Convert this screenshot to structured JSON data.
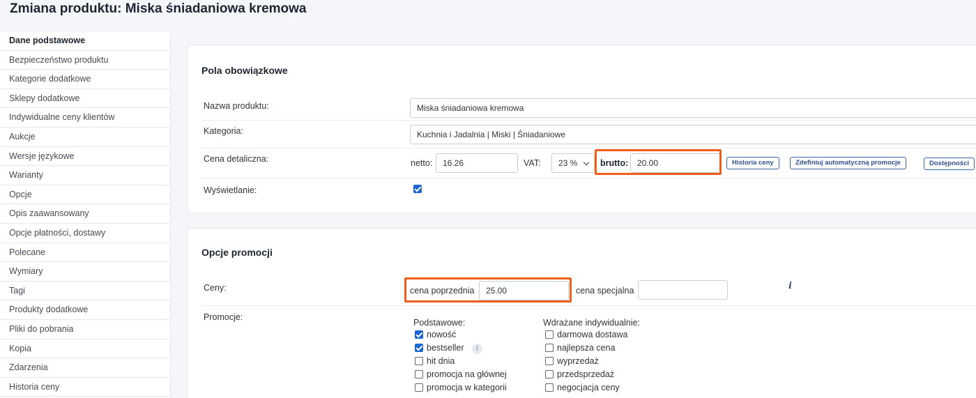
{
  "page": {
    "title": "Zmiana produktu: Miska śniadaniowa kremowa"
  },
  "sidebar": {
    "items": [
      {
        "label": "Dane podstawowe",
        "active": true
      },
      {
        "label": "Bezpieczeństwo produktu"
      },
      {
        "label": "Kategorie dodatkowe"
      },
      {
        "label": "Sklepy dodatkowe"
      },
      {
        "label": "Indywidualne ceny klientów"
      },
      {
        "label": "Aukcje"
      },
      {
        "label": "Wersje językowe"
      },
      {
        "label": "Warianty"
      },
      {
        "label": "Opcje"
      },
      {
        "label": "Opis zaawansowany"
      },
      {
        "label": "Opcje płatności, dostawy"
      },
      {
        "label": "Polecane"
      },
      {
        "label": "Wymiary"
      },
      {
        "label": "Tagi"
      },
      {
        "label": "Produkty dodatkowe"
      },
      {
        "label": "Pliki do pobrania"
      },
      {
        "label": "Kopia"
      },
      {
        "label": "Zdarzenia"
      },
      {
        "label": "Historia ceny"
      }
    ]
  },
  "required": {
    "title": "Pola obowiązkowe",
    "name": {
      "label": "Nazwa produktu:",
      "value": "Miska śniadaniowa kremowa"
    },
    "category": {
      "label": "Kategoria:",
      "value": "Kuchnia i Jadalnia | Miski | Śniadaniowe"
    },
    "price": {
      "label": "Cena detaliczna:",
      "netto_label": "netto:",
      "netto_value": "16.26",
      "vat_label": "VAT:",
      "vat_value": "23 %",
      "brutto_label": "brutto:",
      "brutto_value": "20.00",
      "history_button": "Historia ceny",
      "auto_promo_button": "Zdefiniuj automatyczną promocje",
      "availability_button": "Dostępności"
    },
    "display": {
      "label": "Wyświetlanie:",
      "checked": true
    }
  },
  "promo": {
    "title": "Opcje promocji",
    "prices": {
      "label": "Ceny:",
      "previous_label": "cena poprzednia",
      "previous_value": "25.00",
      "special_label": "cena specjalna",
      "special_value": "",
      "info_icon": "i"
    },
    "promotions": {
      "label": "Promocje:",
      "basic_header": "Podstawowe:",
      "basic": [
        {
          "label": "nowość",
          "checked": true
        },
        {
          "label": "bestseller",
          "checked": true,
          "info": "i"
        },
        {
          "label": "hit dnia",
          "checked": false
        },
        {
          "label": "promocja na głównej",
          "checked": false
        },
        {
          "label": "promocja w kategorii",
          "checked": false
        }
      ],
      "custom_header": "Wdrażane indywidualnie:",
      "custom": [
        {
          "label": "darmowa dostawa",
          "checked": false
        },
        {
          "label": "najlepsza cena",
          "checked": false
        },
        {
          "label": "wyprzedaż",
          "checked": false
        },
        {
          "label": "przedsprzedaż",
          "checked": false
        },
        {
          "label": "negocjacja ceny",
          "checked": false
        }
      ]
    }
  },
  "colors": {
    "highlight": "#ee5f1c",
    "checkbox": "#1b66d2",
    "button_border": "#3b63a8"
  }
}
